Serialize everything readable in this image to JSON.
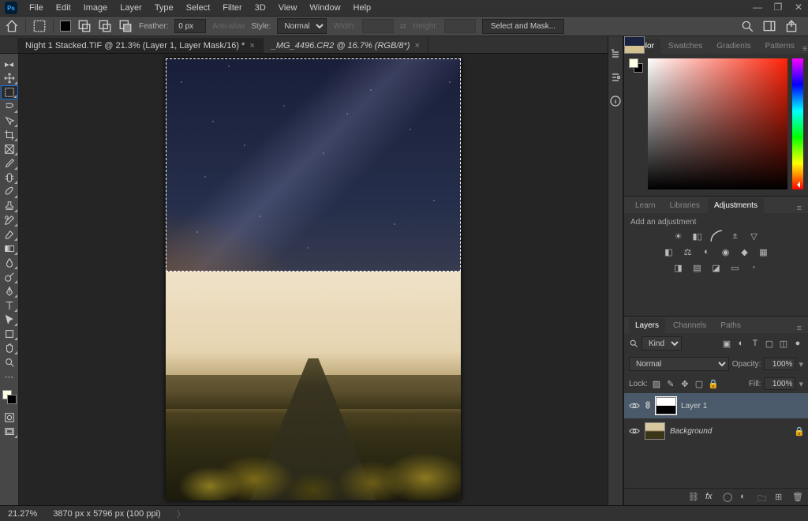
{
  "app": {
    "logo": "Ps"
  },
  "menubar": [
    "File",
    "Edit",
    "Image",
    "Layer",
    "Type",
    "Select",
    "Filter",
    "3D",
    "View",
    "Window",
    "Help"
  ],
  "optbar": {
    "feather_label": "Feather:",
    "feather_value": "0 px",
    "antialias": "Anti-alias",
    "style_label": "Style:",
    "style_value": "Normal",
    "width_label": "Width:",
    "height_label": "Height:",
    "mask_btn": "Select and Mask..."
  },
  "tabs": [
    {
      "title": "Night 1 Stacked.TIF @ 21.3% (Layer 1, Layer Mask/16) *",
      "active": true
    },
    {
      "title": "_MG_4496.CR2 @ 16.7% (RGB/8*)",
      "active": false
    }
  ],
  "colorpanel": {
    "tabs": [
      "Color",
      "Swatches",
      "Gradients",
      "Patterns"
    ],
    "active": 0
  },
  "adjpanel": {
    "tabs": [
      "Learn",
      "Libraries",
      "Adjustments"
    ],
    "active": 2,
    "hint": "Add an adjustment"
  },
  "layerspanel": {
    "tabs": [
      "Layers",
      "Channels",
      "Paths"
    ],
    "active": 0,
    "filter_label": "Kind",
    "blend_mode": "Normal",
    "opacity_label": "Opacity:",
    "opacity": "100%",
    "lock_label": "Lock:",
    "fill_label": "Fill:",
    "fill": "100%",
    "layers": [
      {
        "name": "Layer 1",
        "selected": true,
        "hasMask": true,
        "italic": false,
        "locked": false
      },
      {
        "name": "Background",
        "selected": false,
        "hasMask": false,
        "italic": true,
        "locked": true
      }
    ]
  },
  "status": {
    "zoom": "21.27%",
    "dims": "3870 px x 5796 px (100 ppi)"
  }
}
